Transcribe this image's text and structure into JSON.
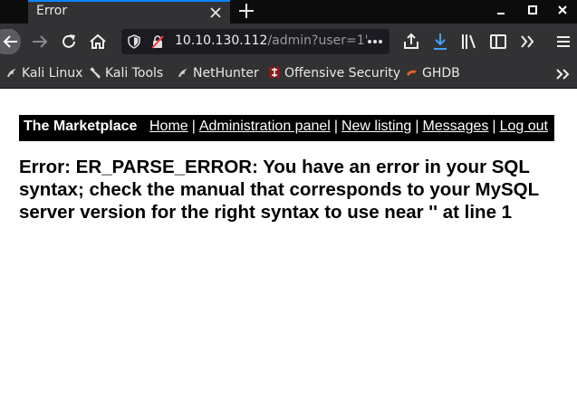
{
  "browser": {
    "tab": {
      "title": "Error"
    },
    "url": {
      "host": "10.10.130.112",
      "path": "/admin?user=1'"
    },
    "bookmarks": [
      {
        "label": "Kali Linux",
        "icon": "kali-dragon-icon"
      },
      {
        "label": "Kali Tools",
        "icon": "kali-tools-icon"
      },
      {
        "label": "NetHunter",
        "icon": "kali-dragon-icon"
      },
      {
        "label": "Offensive Security",
        "icon": "offsec-icon"
      },
      {
        "label": "GHDB",
        "icon": "ghdb-icon"
      }
    ],
    "colors": {
      "accent": "#0a84ff",
      "toolbar": "#323234",
      "tabbar": "#0c0c0d"
    }
  },
  "site": {
    "brand": "The Marketplace",
    "nav": {
      "home": "Home",
      "admin": "Administration panel",
      "new_listing": "New listing",
      "messages": "Messages",
      "logout": "Log out",
      "separator": "|"
    }
  },
  "error": {
    "message": "Error: ER_PARSE_ERROR: You have an error in your SQL syntax; check the manual that corresponds to your MySQL server version for the right syntax to use near '' at line 1"
  }
}
